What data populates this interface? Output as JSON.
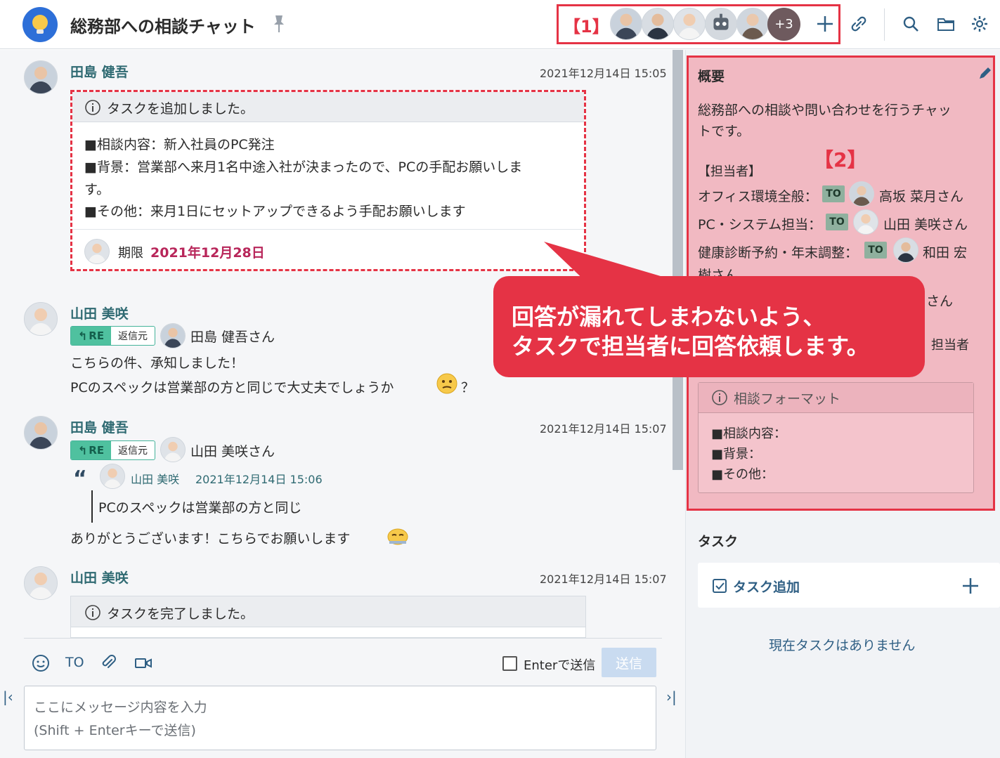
{
  "header": {
    "title": "総務部への相談チャット",
    "plus3": "+3",
    "annotation1": "【1】"
  },
  "messages": [
    {
      "name": "田島 健吾",
      "timestamp": "2021年12月14日 15:05",
      "task": {
        "header": "タスクを追加しました。",
        "line1": "■相談内容：新入社員のPC発注",
        "line2a": "■背景：営業部へ来月1名中途入社が決まったので、PCの手配お願いしま",
        "line2b": "す。",
        "line3": "■その他：来月1日にセットアップできるよう手配お願いします",
        "due_label": "期限",
        "due_date": "2021年12月28日"
      }
    },
    {
      "name": "山田 美咲",
      "re_label": "RE",
      "re_text": "返信元",
      "reply_to": "田島 健吾さん",
      "line1": "こちらの件、承知しました！",
      "line2": "PCのスペックは営業部の方と同じで大丈夫でしょうか",
      "line2_end": "？"
    },
    {
      "name": "田島 健吾",
      "timestamp": "2021年12月14日 15:07",
      "re_label": "RE",
      "re_text": "返信元",
      "reply_to": "山田 美咲さん",
      "quote_name": "山田 美咲",
      "quote_time": "2021年12月14日 15:06",
      "quote_text": "PCのスペックは営業部の方と同じ",
      "line1": "ありがとうございます！こちらでお願いします"
    },
    {
      "name": "山田 美咲",
      "timestamp": "2021年12月14日 15:07",
      "task_header": "タスクを完了しました。"
    }
  ],
  "composer": {
    "to_label": "TO",
    "enter_label": "Enterで送信",
    "send_label": "送信",
    "placeholder1": "ここにメッセージ内容を入力",
    "placeholder2": "(Shift + Enterキーで送信)"
  },
  "overview": {
    "title": "概要",
    "desc1": "総務部への相談や問い合わせを行うチャッ",
    "desc2": "トです。",
    "annotation2": "【2】",
    "staff_heading": "【担当者】",
    "staff": [
      {
        "role": "オフィス環境全般：",
        "to": "TO",
        "name": "高坂 菜月さん"
      },
      {
        "role": "PC・システム担当：",
        "to": "TO",
        "name": "山田 美咲さん"
      },
      {
        "role": "健康診断予約・年末調整：",
        "to": "TO",
        "name": "和田 宏",
        "name2": "樹さん"
      }
    ],
    "partial1": "さん",
    "partial2": "担当者",
    "format": {
      "header": "相談フォーマット",
      "line1": "■相談内容：",
      "line2": "■背景：",
      "line3": "■その他："
    }
  },
  "tasks": {
    "title": "タスク",
    "add_label": "タスク追加",
    "empty": "現在タスクはありません"
  },
  "callout": {
    "line1": "回答が漏れてしまわないよう、",
    "line2": "タスクで担当者に回答依頼します。"
  }
}
